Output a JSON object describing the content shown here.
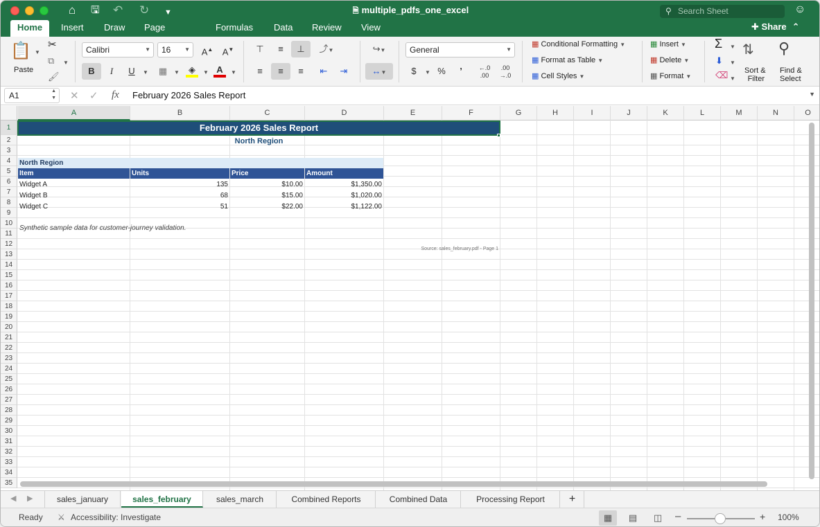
{
  "window": {
    "title": "multiple_pdfs_one_excel",
    "search_placeholder": "Search Sheet"
  },
  "menu_tabs": [
    "Home",
    "Insert",
    "Draw",
    "Page Layout",
    "Formulas",
    "Data",
    "Review",
    "View"
  ],
  "share_label": "Share",
  "ribbon": {
    "paste_label": "Paste",
    "font_name": "Calibri",
    "font_size": "16",
    "bold": "B",
    "italic": "I",
    "underline": "U",
    "number_format": "General",
    "currency": "$",
    "percent": "%",
    "comma": "’",
    "conditional_formatting": "Conditional Formatting",
    "format_as_table": "Format as Table",
    "cell_styles": "Cell Styles",
    "insert": "Insert",
    "delete": "Delete",
    "format": "Format",
    "sort_filter_1": "Sort &",
    "sort_filter_2": "Filter",
    "find_select_1": "Find &",
    "find_select_2": "Select"
  },
  "formula_bar": {
    "name_box": "A1",
    "fx": "fx",
    "content": "February 2026 Sales Report"
  },
  "columns": [
    "A",
    "B",
    "C",
    "D",
    "E",
    "F",
    "G",
    "H",
    "I",
    "J",
    "K",
    "L",
    "M",
    "N",
    "O"
  ],
  "rows": [
    "1",
    "2",
    "3",
    "4",
    "5",
    "6",
    "7",
    "8",
    "9",
    "10",
    "11",
    "12",
    "13",
    "14",
    "15",
    "16",
    "17",
    "18",
    "19",
    "20",
    "21",
    "22",
    "23",
    "24",
    "25",
    "26",
    "27",
    "28",
    "29",
    "30",
    "31",
    "32",
    "33",
    "34",
    "35"
  ],
  "sheet": {
    "title": "February 2026 Sales Report",
    "subtitle": "North Region",
    "section_label": "North Region",
    "headers": [
      "Item",
      "Units",
      "Price",
      "Amount"
    ],
    "data_rows": [
      [
        "Widget A",
        "135",
        "$10.00",
        "$1,350.00"
      ],
      [
        "Widget B",
        "68",
        "$15.00",
        "$1,020.00"
      ],
      [
        "Widget C",
        "51",
        "$22.00",
        "$1,122.00"
      ]
    ],
    "note": "Synthetic sample data for customer-journey validation.",
    "source": "Source: sales_february.pdf - Page 1"
  },
  "sheet_tabs": [
    "sales_january",
    "sales_february",
    "sales_march",
    "Combined Reports",
    "Combined Data",
    "Processing Report"
  ],
  "active_sheet": "sales_february",
  "status": {
    "ready": "Ready",
    "accessibility": "Accessibility: Investigate",
    "zoom": "100%"
  },
  "colors": {
    "excel_green": "#217346",
    "title_fill": "#1f4e79",
    "header_fill": "#2f5496",
    "section_fill": "#ddebf7"
  }
}
